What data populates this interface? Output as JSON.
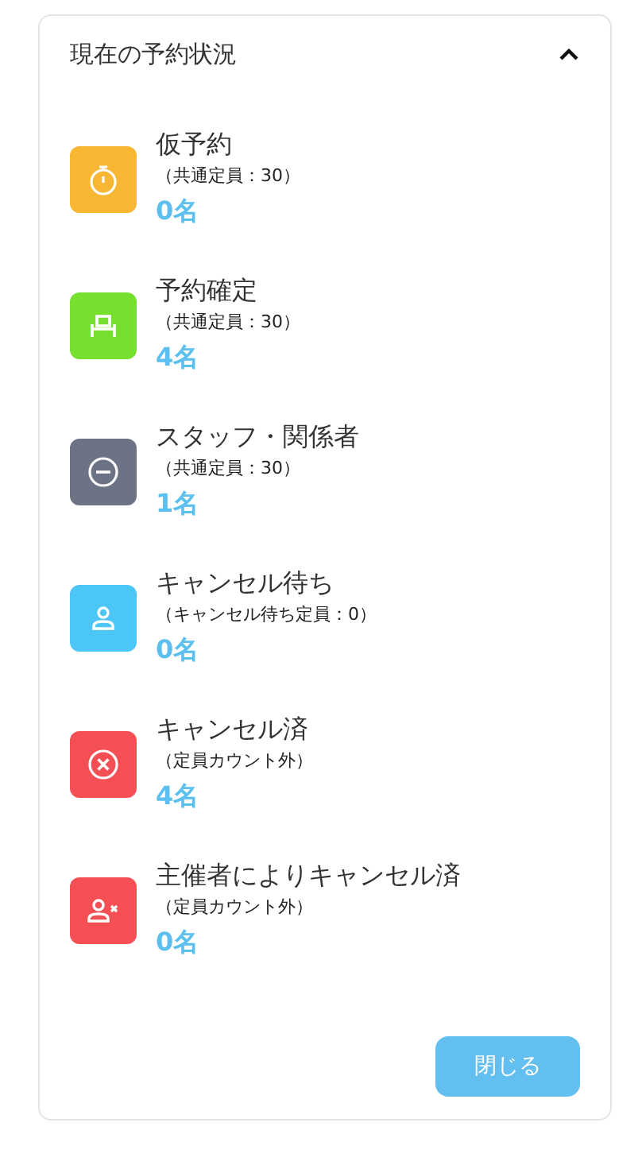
{
  "panel": {
    "title": "現在の予約状況",
    "expanded": true
  },
  "statuses": [
    {
      "kind": "timer",
      "color": "#f7b733",
      "label": "仮予約",
      "capacity": "（共通定員：30）",
      "count": "0名"
    },
    {
      "kind": "seat",
      "color": "#76e02f",
      "label": "予約確定",
      "capacity": "（共通定員：30）",
      "count": "4名"
    },
    {
      "kind": "minus",
      "color": "#6b7385",
      "label": "スタッフ・関係者",
      "capacity": "（共通定員：30）",
      "count": "1名"
    },
    {
      "kind": "person",
      "color": "#4cc5f7",
      "label": "キャンセル待ち",
      "capacity": "（キャンセル待ち定員：0）",
      "count": "0名"
    },
    {
      "kind": "cross",
      "color": "#f44f55",
      "label": "キャンセル済",
      "capacity": "（定員カウント外）",
      "count": "4名"
    },
    {
      "kind": "person-cross",
      "color": "#f44f55",
      "label": "主催者によりキャンセル済",
      "capacity": "（定員カウント外）",
      "count": "0名"
    }
  ],
  "close_button": "閉じる"
}
